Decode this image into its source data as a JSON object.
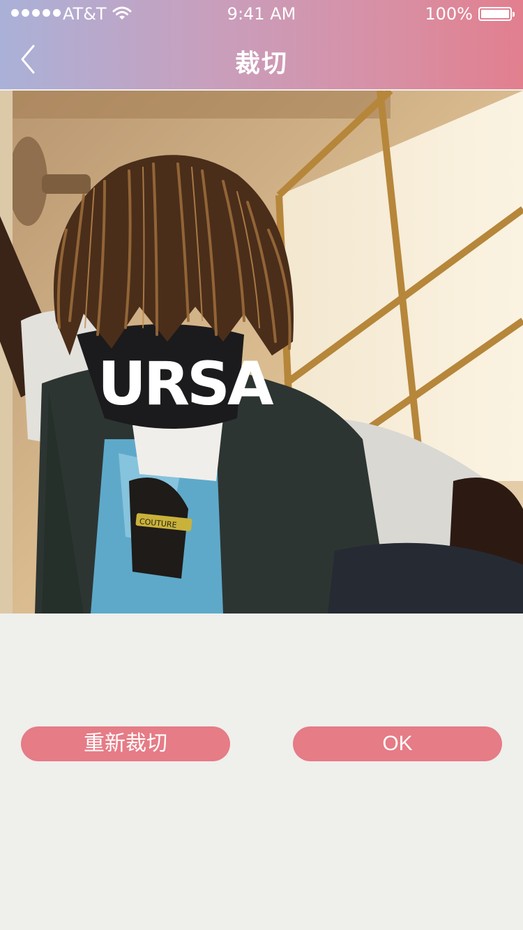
{
  "status_bar": {
    "carrier": "AT&T",
    "time": "9:41 AM",
    "battery": "100%"
  },
  "nav": {
    "title": "裁切",
    "back_icon": "chevron-left-icon"
  },
  "photo": {
    "shirt_text": "URSA",
    "badge_text": "COUTURE"
  },
  "actions": {
    "recrop_label": "重新裁切",
    "ok_label": "OK"
  },
  "colors": {
    "header_gradient_start": "#aab1d8",
    "header_gradient_end": "#e27f8e",
    "button": "#e57c86",
    "background": "#efefec"
  }
}
